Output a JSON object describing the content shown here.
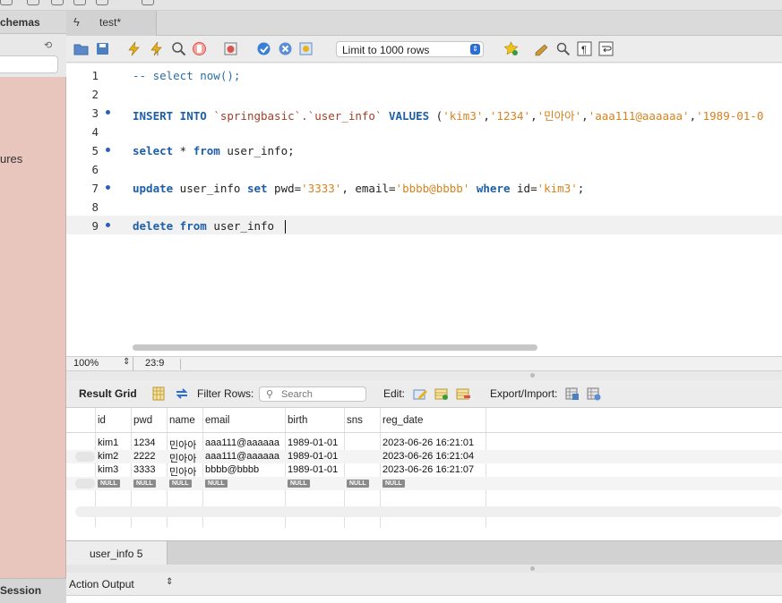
{
  "sidebar": {
    "header": "chemas",
    "partial_item": "ures",
    "footer": "Session"
  },
  "tabs": [
    {
      "label": "test*"
    }
  ],
  "toolbar": {
    "limit_select": "Limit to 1000 rows"
  },
  "editor": {
    "lines": [
      {
        "num": "1",
        "marker": false
      },
      {
        "num": "2",
        "marker": false
      },
      {
        "num": "3",
        "marker": true
      },
      {
        "num": "4",
        "marker": false
      },
      {
        "num": "5",
        "marker": true
      },
      {
        "num": "6",
        "marker": false
      },
      {
        "num": "7",
        "marker": true
      },
      {
        "num": "8",
        "marker": false
      },
      {
        "num": "9",
        "marker": true
      }
    ],
    "code": {
      "l1": "-- select now();",
      "l3_kw": "INSERT INTO",
      "l3_id": " `springbasic`.`user_info` ",
      "l3_kw2": "VALUES",
      "l3_rest": " (",
      "l3_s1": "'kim3'",
      "l3_s2": "'1234'",
      "l3_s3": "'민아아'",
      "l3_s4": "'aaa111@aaaaaa'",
      "l3_s5": "'1989-01-0",
      "comma": ",",
      "l5_kw": "select",
      "l5_a": " * ",
      "l5_kw2": "from",
      "l5_b": " user_info;",
      "l7_kw": "update",
      "l7_a": " user_info ",
      "l7_kw2": "set",
      "l7_b": " pwd=",
      "l7_s1": "'3333'",
      "l7_c": ", email=",
      "l7_s2": "'bbbb@bbbb'",
      "l7_kw3": " where",
      "l7_d": " id=",
      "l7_s3": "'kim3'",
      "l7_e": ";",
      "l9_kw": "delete",
      "l9_kw2": " from",
      "l9_a": " user_info "
    }
  },
  "status": {
    "zoom": "100%",
    "cursor": "23:9"
  },
  "results": {
    "grid_label": "Result Grid",
    "filter_label": "Filter Rows:",
    "search_placeholder": "Search",
    "edit_label": "Edit:",
    "export_label": "Export/Import:",
    "columns": [
      "id",
      "pwd",
      "name",
      "email",
      "birth",
      "sns",
      "reg_date"
    ],
    "rows": [
      [
        "kim1",
        "1234",
        "민아아",
        "aaa111@aaaaaa",
        "1989-01-01",
        "",
        "2023-06-26 16:21:01"
      ],
      [
        "kim2",
        "2222",
        "민아아",
        "aaa111@aaaaaa",
        "1989-01-01",
        "",
        "2023-06-26 16:21:04"
      ],
      [
        "kim3",
        "3333",
        "bbbb@bbbb",
        "1989-01-01",
        "",
        "2023-06-26 16:21:07"
      ]
    ],
    "null_label": "NULL",
    "tab": "user_info 5",
    "action_output": "Action Output"
  }
}
